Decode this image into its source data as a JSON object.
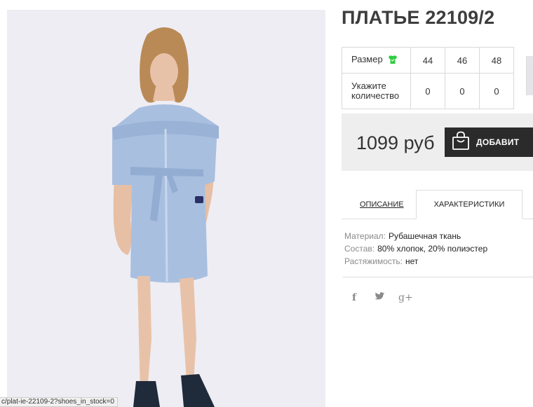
{
  "product": {
    "title": "ПЛАТЬЕ 22109/2",
    "image_icon": "product-photo-woman-blue-striped-shirt-dress"
  },
  "sizes": {
    "size_label": "Размер",
    "size_icon": "tshirt-icon",
    "size_icon_color": "#2ecc40",
    "values": [
      "44",
      "46",
      "48"
    ],
    "qty_label_line1": "Укажите",
    "qty_label_line2": "количество",
    "quantities": [
      "0",
      "0",
      "0"
    ]
  },
  "buy": {
    "price": "1099 руб",
    "add_label": "ДОБАВИТ",
    "cart_icon": "shopping-bag-icon",
    "button_color": "#2b2b2b"
  },
  "tabs": {
    "description": "ОПИСАНИЕ",
    "characteristics": "ХАРАКТЕРИСТИКИ"
  },
  "characteristics": [
    {
      "key": "Материал:",
      "value": "Рубашечная ткань"
    },
    {
      "key": "Состав:",
      "value": "80% хлопок, 20% полиэстер"
    },
    {
      "key": "Растяжимость:",
      "value": "нет"
    }
  ],
  "social": {
    "facebook": "f",
    "twitter_icon": "twitter-bird-icon",
    "googleplus": "g+"
  },
  "statusbar": {
    "url": "c/plat-ie-22109-2?shoes_in_stock=0"
  }
}
